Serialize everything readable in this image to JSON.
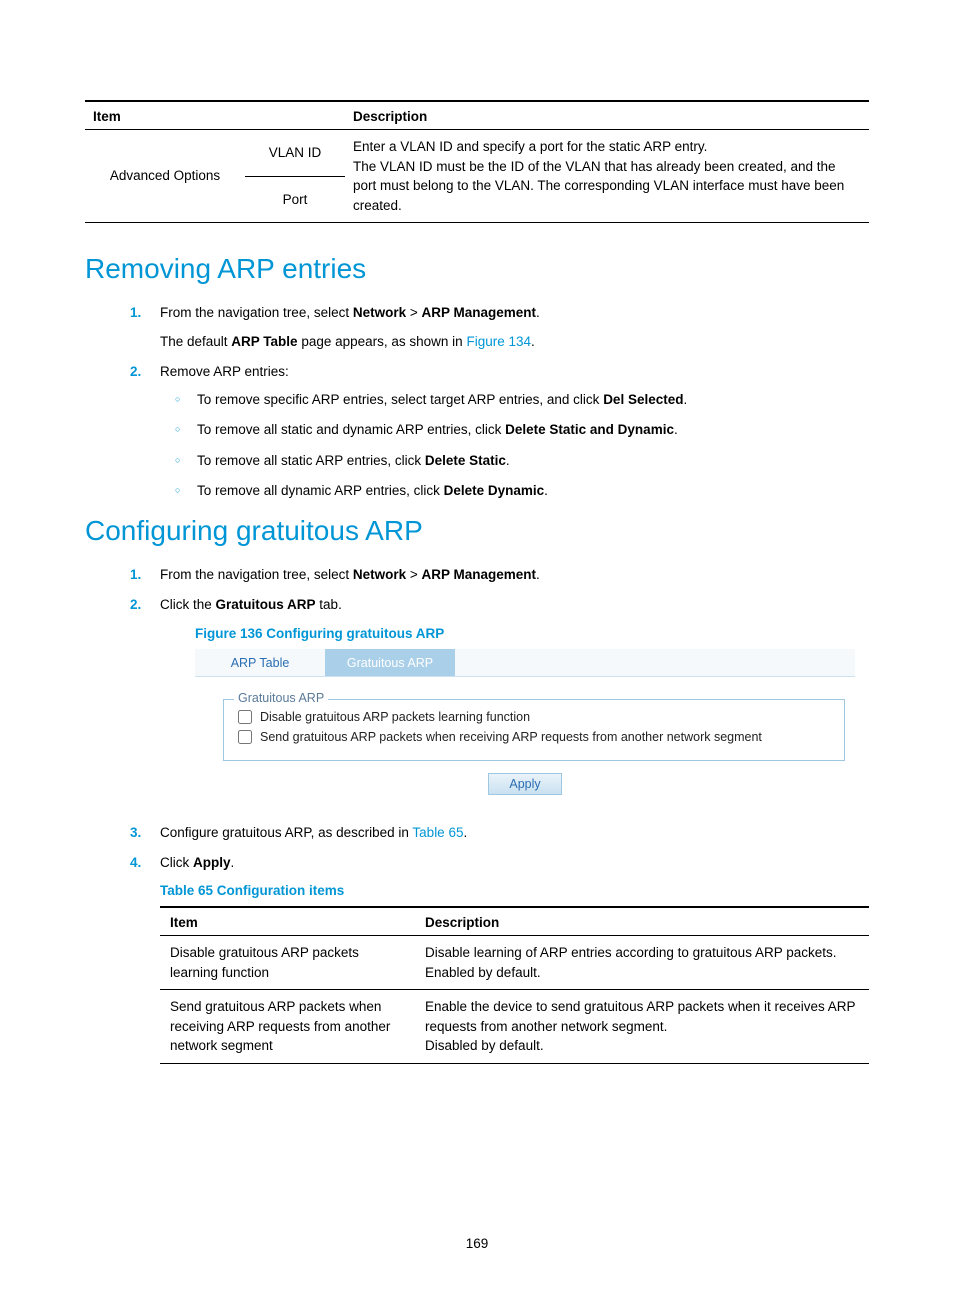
{
  "topTable": {
    "headers": {
      "item": "Item",
      "desc": "Description"
    },
    "group": "Advanced Options",
    "rows": [
      {
        "sub": "VLAN ID",
        "desc": [
          "Enter a VLAN ID and specify a port for the static ARP entry.",
          "The VLAN ID must be the ID of the VLAN that has already been created, and the port must belong to the VLAN. The corresponding VLAN interface must have been created."
        ]
      },
      {
        "sub": "Port"
      }
    ]
  },
  "section1": {
    "heading": "Removing ARP entries",
    "steps": [
      {
        "num": "1.",
        "parts": [
          {
            "t": "From the navigation tree, select "
          },
          {
            "t": "Network",
            "b": true
          },
          {
            "t": " > "
          },
          {
            "t": "ARP Management",
            "b": true
          },
          {
            "t": "."
          }
        ],
        "after": [
          {
            "t": "The default "
          },
          {
            "t": "ARP Table",
            "b": true
          },
          {
            "t": " page appears, as shown in "
          },
          {
            "t": "Figure 134",
            "link": true
          },
          {
            "t": "."
          }
        ]
      },
      {
        "num": "2.",
        "parts": [
          {
            "t": "Remove ARP entries:"
          }
        ],
        "bullets": [
          [
            {
              "t": "To remove specific ARP entries, select target ARP entries, and click "
            },
            {
              "t": "Del Selected",
              "b": true
            },
            {
              "t": "."
            }
          ],
          [
            {
              "t": "To remove all static and dynamic ARP entries, click "
            },
            {
              "t": "Delete Static and Dynamic",
              "b": true
            },
            {
              "t": "."
            }
          ],
          [
            {
              "t": "To remove all static ARP entries, click "
            },
            {
              "t": "Delete Static",
              "b": true
            },
            {
              "t": "."
            }
          ],
          [
            {
              "t": "To remove all dynamic ARP entries, click "
            },
            {
              "t": "Delete Dynamic",
              "b": true
            },
            {
              "t": "."
            }
          ]
        ]
      }
    ]
  },
  "section2": {
    "heading": "Configuring gratuitous ARP",
    "steps1": [
      {
        "num": "1.",
        "parts": [
          {
            "t": "From the navigation tree, select "
          },
          {
            "t": "Network",
            "b": true
          },
          {
            "t": " > "
          },
          {
            "t": "ARP Management",
            "b": true
          },
          {
            "t": "."
          }
        ]
      },
      {
        "num": "2.",
        "parts": [
          {
            "t": "Click the "
          },
          {
            "t": "Gratuitous ARP",
            "b": true
          },
          {
            "t": " tab."
          }
        ]
      }
    ],
    "figCaption": "Figure 136 Configuring gratuitous ARP",
    "screenshot": {
      "tab1": "ARP Table",
      "tab2": "Gratuitous ARP",
      "legend": "Gratuitous ARP",
      "chk1": "Disable gratuitous ARP packets learning function",
      "chk2": "Send gratuitous ARP packets when receiving ARP requests from another network segment",
      "apply": "Apply"
    },
    "steps2": [
      {
        "num": "3.",
        "parts": [
          {
            "t": "Configure gratuitous ARP, as described in "
          },
          {
            "t": "Table 65",
            "link": true
          },
          {
            "t": "."
          }
        ]
      },
      {
        "num": "4.",
        "parts": [
          {
            "t": "Click "
          },
          {
            "t": "Apply",
            "b": true
          },
          {
            "t": "."
          }
        ]
      }
    ],
    "tableCaption": "Table 65 Configuration items",
    "botTable": {
      "headers": {
        "item": "Item",
        "desc": "Description"
      },
      "rows": [
        {
          "item": "Disable gratuitous ARP packets learning function",
          "desc": [
            "Disable learning of ARP entries according to gratuitous ARP packets.",
            "Enabled by default."
          ]
        },
        {
          "item": "Send gratuitous ARP packets when receiving ARP requests from another network segment",
          "desc": [
            "Enable the device to send gratuitous ARP packets when it receives ARP requests from another network segment.",
            "Disabled by default."
          ]
        }
      ]
    }
  },
  "pageNumber": "169"
}
